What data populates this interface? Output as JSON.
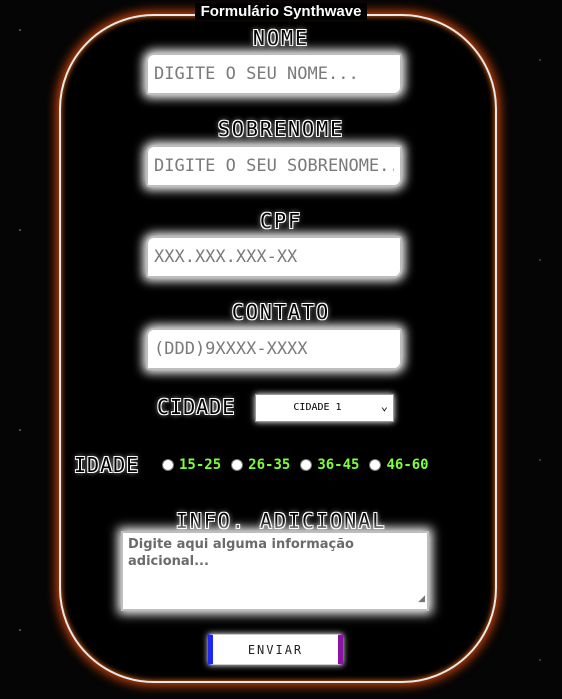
{
  "form": {
    "legend": "Formulário Synthwave",
    "nome": {
      "label": "NOME",
      "placeholder": "DIGITE O SEU NOME..."
    },
    "sobrenome": {
      "label": "SOBRENOME",
      "placeholder": "DIGITE O SEU SOBRENOME..."
    },
    "cpf": {
      "label": "CPF",
      "placeholder": "XXX.XXX.XXX-XX"
    },
    "contato": {
      "label": "CONTATO",
      "placeholder": "(DDD)9XXXX-XXXX"
    },
    "cidade": {
      "label": "CIDADE",
      "selected": "CIDADE 1"
    },
    "idade": {
      "label": "IDADE",
      "options": [
        "15-25",
        "26-35",
        "36-45",
        "46-60"
      ]
    },
    "info": {
      "label": "INFO. ADICIONAL",
      "placeholder": "Digite aqui alguma informação adicional..."
    },
    "submit_label": "ENVIAR"
  },
  "colors": {
    "frame_glow": "#c2410c",
    "radio_label": "#7dff3a",
    "button_left": "#1d27f0",
    "button_right": "#8a12a6"
  }
}
